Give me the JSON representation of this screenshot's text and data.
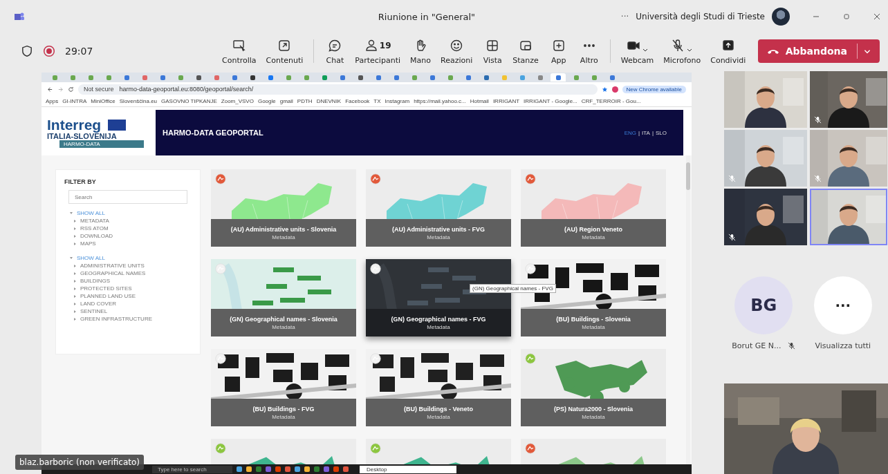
{
  "window": {
    "title": "Riunione in \"General\"",
    "more": "···",
    "organization": "Università degli Studi di Trieste"
  },
  "toolbar": {
    "timer": "29:07",
    "recording": true,
    "buttons": [
      {
        "kind": "control",
        "label": "Controlla"
      },
      {
        "kind": "content",
        "label": "Contenuti"
      },
      {
        "kind": "chat",
        "label": "Chat"
      },
      {
        "kind": "people",
        "label": "Partecipanti",
        "count": "19"
      },
      {
        "kind": "hand",
        "label": "Mano"
      },
      {
        "kind": "emoji",
        "label": "Reazioni"
      },
      {
        "kind": "grid",
        "label": "Vista"
      },
      {
        "kind": "rooms",
        "label": "Stanze"
      },
      {
        "kind": "add",
        "label": "App"
      },
      {
        "kind": "more",
        "label": "Altro"
      },
      {
        "kind": "camera",
        "label": "Webcam",
        "dropdown": true
      },
      {
        "kind": "mic-off",
        "label": "Microfono",
        "dropdown": true
      },
      {
        "kind": "share",
        "label": "Condividi"
      }
    ],
    "leave": "Abbandona"
  },
  "shared_screen": {
    "browser_tabs": [
      {
        "selected": false
      },
      {
        "selected": false
      },
      {
        "selected": false
      },
      {
        "selected": false
      },
      {
        "selected": false
      },
      {
        "selected": false
      },
      {
        "selected": false
      },
      {
        "selected": false
      },
      {
        "selected": false
      },
      {
        "selected": false
      },
      {
        "selected": false
      },
      {
        "selected": false
      },
      {
        "selected": false
      },
      {
        "selected": false
      },
      {
        "selected": false
      },
      {
        "selected": false
      },
      {
        "selected": false
      },
      {
        "selected": false
      },
      {
        "selected": false
      },
      {
        "selected": false
      },
      {
        "selected": false
      },
      {
        "selected": false
      },
      {
        "selected": false
      },
      {
        "selected": false
      },
      {
        "selected": false
      },
      {
        "selected": false
      },
      {
        "selected": false
      },
      {
        "selected": false
      },
      {
        "selected": true
      },
      {
        "selected": false
      },
      {
        "selected": false
      },
      {
        "selected": false
      }
    ],
    "address_bar": {
      "security": "Not secure",
      "url": "harmo-data-geoportal.eu:8080/geoportal/search/",
      "update": "New Chrome available"
    },
    "bookmarks": [
      "Apps",
      "GI-INTRA",
      "MiniOffice",
      "Slovenščina.eu",
      "GASOVNO TIPKANJE",
      "Zoom_VSVO",
      "Google",
      "gmail",
      "PDTH",
      "DNEVNIK",
      "Facebook",
      "TX",
      "Instagram",
      "https://mail.yahoo.c...",
      "Hotmail",
      "IRRIGANT",
      "IRRIGANT - Google...",
      "CRF_TERROIR - Gou..."
    ],
    "logo": {
      "brand": "Interreg",
      "program": "ITALIA-SLOVENIJA",
      "project": "HARMO-DATA"
    },
    "site_title": "HARMO-DATA GEOPORTAL",
    "languages": [
      {
        "label": "ENG",
        "selected": true
      },
      {
        "label": "ITA",
        "selected": false
      },
      {
        "label": "SLO",
        "selected": false
      }
    ],
    "language_separator": "|",
    "filter": {
      "title": "FILTER BY",
      "placeholder": "Search",
      "groups": [
        {
          "label": "SHOW ALL",
          "expanded": true,
          "children": [
            {
              "label": "METADATA"
            },
            {
              "label": "RSS ATOM"
            },
            {
              "label": "DOWNLOAD"
            },
            {
              "label": "MAPS"
            }
          ]
        },
        {
          "label": "SHOW ALL",
          "expanded": true,
          "children": [
            {
              "label": "ADMINISTRATIVE UNITS"
            },
            {
              "label": "GEOGRAPHICAL NAMES"
            },
            {
              "label": "BUILDINGS"
            },
            {
              "label": "PROTECTED SITES"
            },
            {
              "label": "PLANNED LAND USE"
            },
            {
              "label": "LAND COVER"
            },
            {
              "label": "SENTINEL"
            },
            {
              "label": "GREEN INFRASTRUCTURE"
            }
          ]
        }
      ]
    },
    "cards": [
      {
        "kind": "admin",
        "title": "(AU) Administrative units - Slovenia",
        "subtitle": "Metadata",
        "color": "#8ee88e",
        "hovered": false
      },
      {
        "kind": "admin",
        "title": "(AU) Administrative units - FVG",
        "subtitle": "Metadata",
        "color": "#6fd3d3",
        "hovered": false
      },
      {
        "kind": "admin",
        "title": "(AU) Region Veneto",
        "subtitle": "Metadata",
        "color": "#f4b9b9",
        "hovered": false
      },
      {
        "kind": "names",
        "title": "(GN) Geographical names - Slovenia",
        "subtitle": "Metadata",
        "color": "#3a9a48",
        "hovered": false
      },
      {
        "kind": "names",
        "title": "(GN) Geographical names - FVG",
        "subtitle": "Metadata",
        "color": "#4a5560",
        "hovered": true,
        "tooltip": "(GN) Geographical names - FVG"
      },
      {
        "kind": "buildings",
        "title": "(BU) Buildings - Slovenia",
        "subtitle": "Metadata",
        "color": "#161616",
        "hovered": false
      },
      {
        "kind": "buildings",
        "title": "(BU) Buildings - FVG",
        "subtitle": "Metadata",
        "color": "#1c1c1c",
        "hovered": false
      },
      {
        "kind": "buildings",
        "title": "(BU) Buildings - Veneto",
        "subtitle": "Metadata",
        "color": "#202020",
        "hovered": false
      },
      {
        "kind": "nature",
        "title": "(PS) Natura2000 - Slovenia",
        "subtitle": "Metadata",
        "color": "#4f9a55",
        "hovered": false
      },
      {
        "kind": "nature",
        "color": "#3fb58f",
        "hovered": false
      },
      {
        "kind": "nature",
        "color": "#3fb58f",
        "hovered": false
      },
      {
        "kind": "landuse",
        "color": "#8cc88a",
        "hovered": false
      }
    ],
    "taskbar": {
      "search_placeholder": "Type here to search",
      "popup_item": "Desktop"
    }
  },
  "presenter": {
    "name": "blaz.barboric (non verificato)"
  },
  "participants": {
    "tiles": [
      {
        "muted": false,
        "speaking": false
      },
      {
        "muted": true,
        "speaking": false
      },
      {
        "muted": true,
        "speaking": false
      },
      {
        "muted": true,
        "speaking": false
      },
      {
        "muted": true,
        "speaking": false
      },
      {
        "muted": false,
        "speaking": true
      }
    ],
    "avatar": {
      "initials": "BG",
      "name": "Borut GE N...",
      "muted": true
    },
    "see_all": {
      "symbol": "···",
      "label": "Visualizza tutti"
    }
  }
}
